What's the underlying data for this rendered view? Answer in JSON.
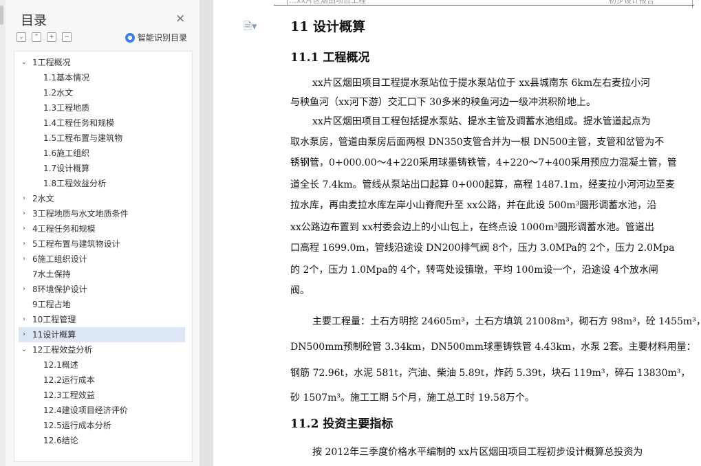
{
  "nav": {
    "title": "目录",
    "close": "×",
    "tools": [
      "⌄",
      "⌃",
      "+",
      "−"
    ],
    "smart_label": "智能识别目录",
    "items": [
      {
        "label": "1工程概况",
        "expander": "⌄",
        "level": 0
      },
      {
        "label": "1.1基本情况",
        "expander": "",
        "level": 1
      },
      {
        "label": "1.2水文",
        "expander": "",
        "level": 1
      },
      {
        "label": "1.3工程地质",
        "expander": "",
        "level": 1
      },
      {
        "label": "1.4工程任务和规模",
        "expander": "",
        "level": 1
      },
      {
        "label": "1.5工程布置与建筑物",
        "expander": "",
        "level": 1
      },
      {
        "label": "1.6施工组织",
        "expander": "",
        "level": 1
      },
      {
        "label": "1.7设计概算",
        "expander": "",
        "level": 1
      },
      {
        "label": "1.8工程效益分析",
        "expander": "",
        "level": 1
      },
      {
        "label": "2水文",
        "expander": "›",
        "level": 0
      },
      {
        "label": "3工程地质与水文地质条件",
        "expander": "›",
        "level": 0
      },
      {
        "label": "4工程任务和规模",
        "expander": "›",
        "level": 0
      },
      {
        "label": "5工程布置与建筑物设计",
        "expander": "›",
        "level": 0
      },
      {
        "label": "6施工组织设计",
        "expander": "›",
        "level": 0
      },
      {
        "label": "7水土保持",
        "expander": "",
        "level": 0
      },
      {
        "label": "8环境保护设计",
        "expander": "›",
        "level": 0
      },
      {
        "label": "9工程占地",
        "expander": "",
        "level": 0
      },
      {
        "label": "10工程管理",
        "expander": "›",
        "level": 0
      },
      {
        "label": "11设计概算",
        "expander": "›",
        "level": 0,
        "selected": true
      },
      {
        "label": "12工程效益分析",
        "expander": "⌄",
        "level": 0
      },
      {
        "label": "12.1概述",
        "expander": "",
        "level": 1
      },
      {
        "label": "12.2运行成本",
        "expander": "",
        "level": 1
      },
      {
        "label": "12.3工程效益",
        "expander": "",
        "level": 1
      },
      {
        "label": "12.4建设项目经济评价",
        "expander": "",
        "level": 1
      },
      {
        "label": "12.5运行成本分析",
        "expander": "",
        "level": 1
      },
      {
        "label": "12.6结论",
        "expander": "",
        "level": 1
      }
    ]
  },
  "doc": {
    "header_left": "…xx片区烟田项目工程",
    "header_right": "初步设计报告",
    "icon": "doc-icon",
    "h1": "11 设计概算",
    "h2_1": "11.1  工程概况",
    "h2_2": "11.2  投资主要指标",
    "lines": [
      {
        "text": "xx片区烟田项目工程提水泵站位于提水泵站位于 xx县城南东 6km左右麦拉小河",
        "indent": true
      },
      {
        "text": "与秧鱼河（xx河下游）交汇口下 30多米的秧鱼河边一级冲洪积阶地上。",
        "indent": false
      },
      {
        "text": "xx片区烟田项目工程包括提水泵站、提水主管及调蓄水池组成。提水管道起点为",
        "indent": true
      },
      {
        "text": "取水泵房，管道由泵房后面两根 DN350支管合并为一根 DN500主管，支管和岔管为不",
        "indent": false
      },
      {
        "text": "锈钢管，0+000.00～4+220采用球墨铸铁管，4+220～7+400采用预应力混凝土管，管",
        "indent": false
      },
      {
        "text": "道全长 7.4km。管线从泵站出口起算 0+000起算，高程 1487.1m，经麦拉小河河边至麦",
        "indent": false
      },
      {
        "text": "拉水库，再由麦拉水库左岸小山脊爬升至 xx公路，并在此设 500m³圆形调蓄水池，沿",
        "indent": false
      },
      {
        "text": "xx公路边布置到 xx村委会边上的小山包上，在终点设 1000m³圆形调蓄水池。管道出",
        "indent": false
      },
      {
        "text": "口高程 1699.0m，管线沿途设 DN200排气阀 8个，压力 3.0MPa的 2个，压力 2.0Mpa",
        "indent": false
      },
      {
        "text": "的 2个，压力 1.0Mpa的 4个，转弯处设镇墩，平均 100m设一个，沿途设 4个放水闸",
        "indent": false
      },
      {
        "text": "阀。",
        "indent": false
      },
      {
        "text": "主要工程量：土石方明挖 24605m³，土石方填筑 21008m³，砌石方 98m³，砼 1455m³，",
        "indent": true
      },
      {
        "text": "DN500mm预制砼管 3.34km，DN500mm球墨铸铁管 4.43km，水泵 2套。主要材料用量：",
        "indent": false
      },
      {
        "text": "钢筋 72.96t，水泥 581t，汽油、柴油 5.89t，炸药 5.39t，块石 119m³，碎石 13830m³，",
        "indent": false
      },
      {
        "text": "砂 1507m³。施工工期 5个月，施工总工时 19.58万个。",
        "indent": false
      },
      {
        "text": "按 2012年三季度价格水平编制的 xx片区烟田项目工程初步设计概算总投资为",
        "indent": true
      }
    ]
  }
}
